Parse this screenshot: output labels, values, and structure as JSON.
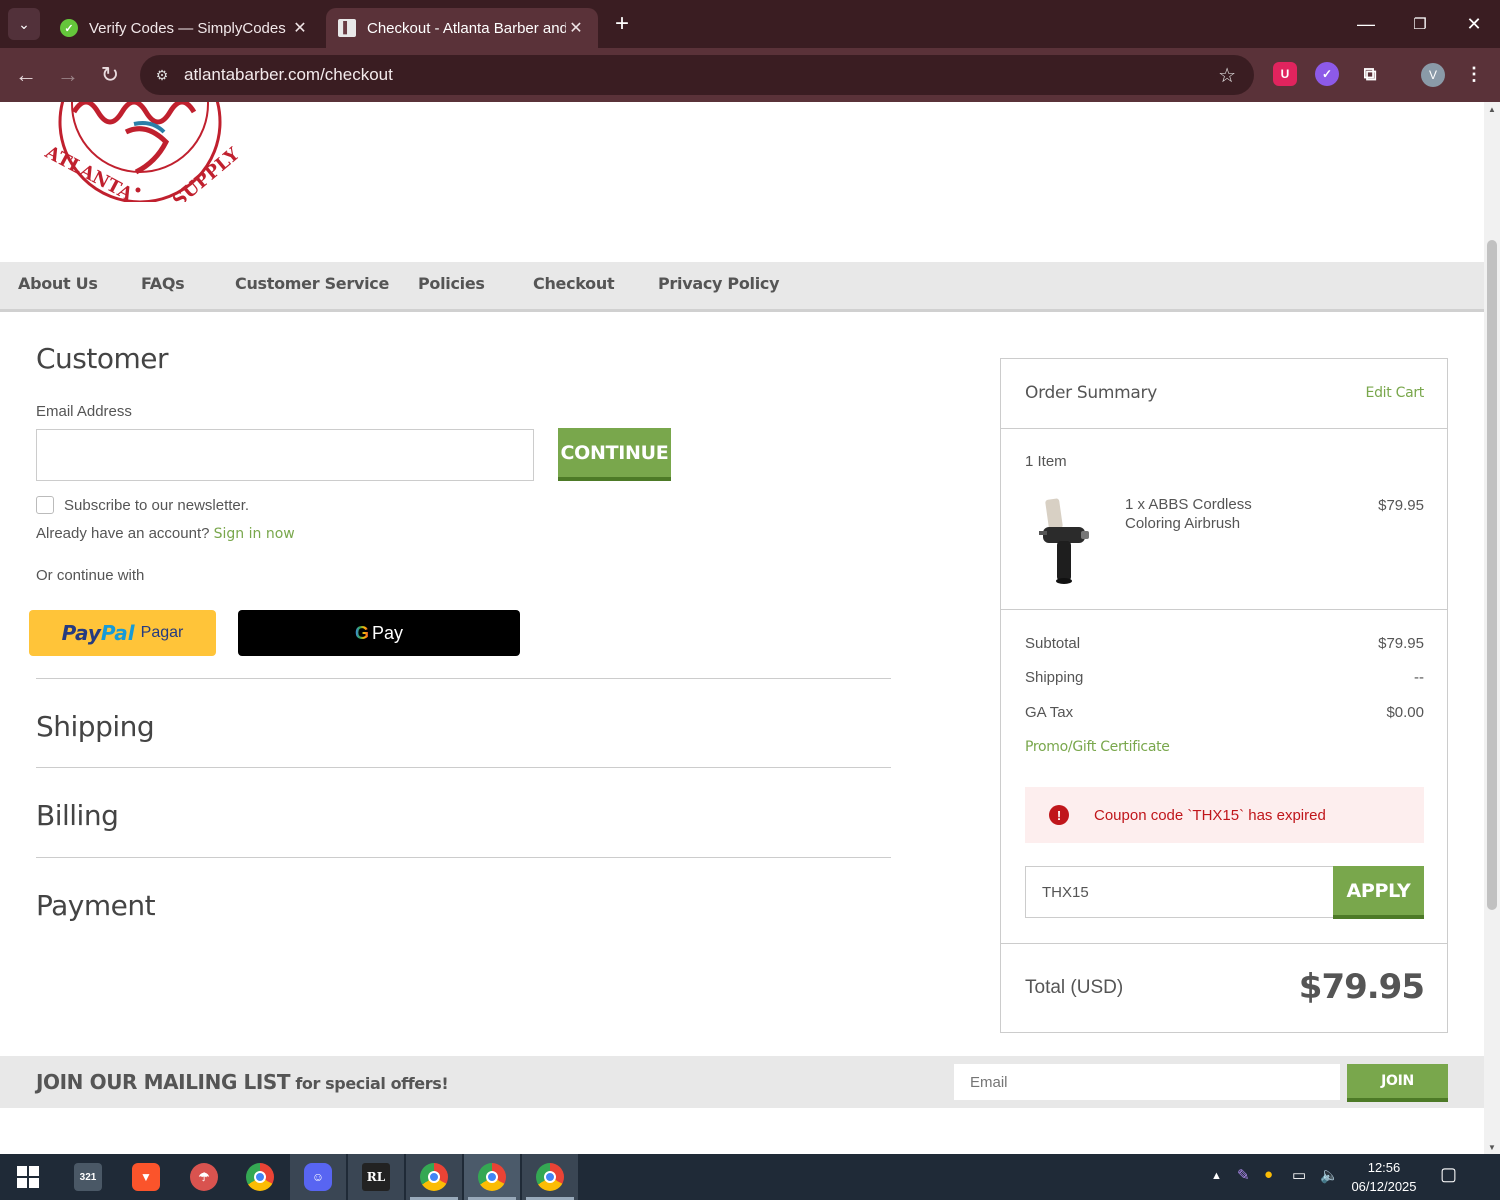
{
  "browser": {
    "tabs": [
      {
        "title": "Verify Codes — SimplyCodes",
        "active": false
      },
      {
        "title": "Checkout - Atlanta Barber and Beauty Supply",
        "active": true
      }
    ],
    "url": "atlantabarber.com/checkout",
    "profile_initial": "V"
  },
  "site": {
    "logo_text_left": "ATLANTA",
    "logo_text_right": "SUPPLY",
    "nav": [
      "About Us",
      "FAQs",
      "Customer Service",
      "Policies",
      "Checkout",
      "Privacy Policy"
    ]
  },
  "customer": {
    "title": "Customer",
    "email_label": "Email Address",
    "email_value": "",
    "continue_label": "CONTINUE",
    "newsletter_label": "Subscribe to our newsletter.",
    "account_prompt": "Already have an account?",
    "sign_in_label": "Sign in now",
    "continue_with": "Or continue with",
    "paypal_brand_a": "Pay",
    "paypal_brand_b": "Pal",
    "paypal_text": "Pagar",
    "gpay_g": "G",
    "gpay_text": "Pay"
  },
  "sections": {
    "shipping": "Shipping",
    "billing": "Billing",
    "payment": "Payment"
  },
  "summary": {
    "title": "Order Summary",
    "edit_cart": "Edit Cart",
    "item_count": "1 Item",
    "item_name": "1 x ABBS Cordless Coloring Airbrush",
    "item_price": "$79.95",
    "subtotal_label": "Subtotal",
    "subtotal_value": "$79.95",
    "shipping_label": "Shipping",
    "shipping_value": "--",
    "tax_label": "GA Tax",
    "tax_value": "$0.00",
    "promo_label": "Promo/Gift Certificate",
    "alert_text": "Coupon code `THX15` has expired",
    "coupon_value": "THX15",
    "apply_label": "APPLY",
    "total_label": "Total (USD)",
    "total_value": "$79.95"
  },
  "mailing": {
    "title_big": "JOIN OUR MAILING LIST",
    "title_small": "for special offers!",
    "email_placeholder": "Email",
    "join_label": "JOIN"
  },
  "taskbar": {
    "time": "12:56",
    "date": "06/12/2025"
  },
  "colors": {
    "accent_green": "#79a74c",
    "browser_frame": "#3a1d22",
    "error_red": "#c0161b",
    "logo_red": "#c0202e"
  }
}
